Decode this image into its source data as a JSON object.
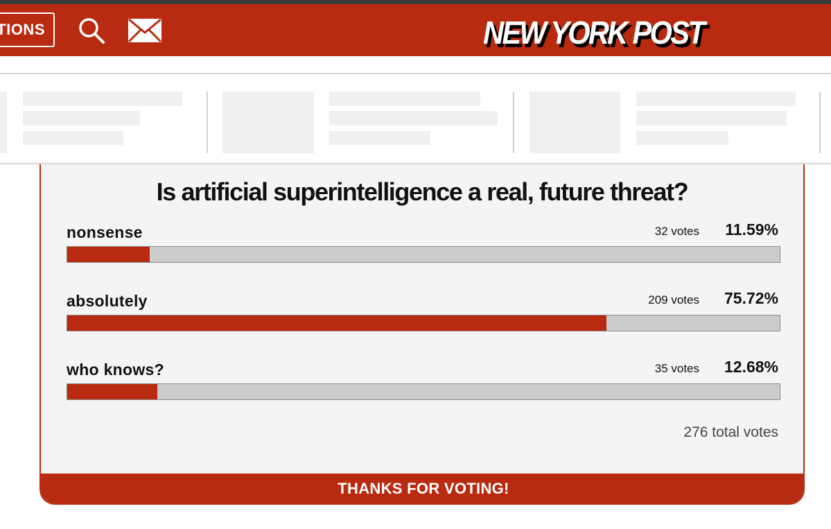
{
  "header": {
    "sections_label": "TIONS",
    "logo_text": "NEW YORK POST",
    "search_icon": "search-icon",
    "mail_icon": "mail-icon",
    "brand_color": "#b82b10"
  },
  "poll": {
    "question": "Is artificial superintelligence a real, future threat?",
    "options": [
      {
        "label": "nonsense",
        "votes": "32 votes",
        "percent": "11.59%",
        "fraction": 0.1159
      },
      {
        "label": "absolutely",
        "votes": "209 votes",
        "percent": "75.72%",
        "fraction": 0.7572
      },
      {
        "label": "who knows?",
        "votes": "35 votes",
        "percent": "12.68%",
        "fraction": 0.1268
      }
    ],
    "total": "276 total votes",
    "thanks": "THANKS FOR VOTING!"
  }
}
